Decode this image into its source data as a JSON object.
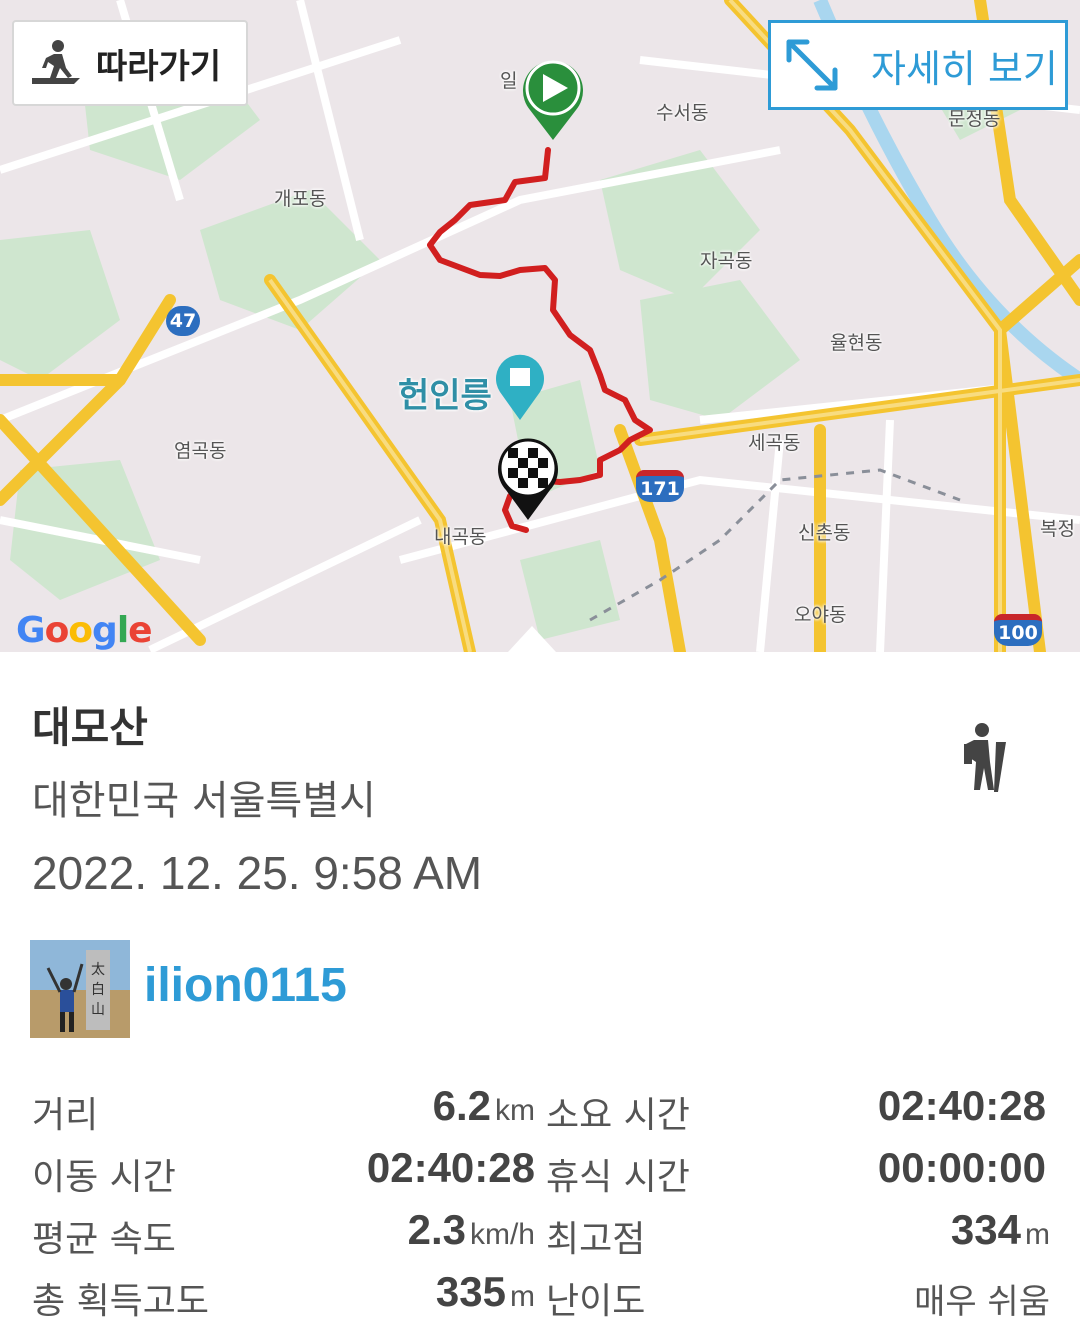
{
  "map": {
    "labels": {
      "il": "일",
      "suseo": "수서동",
      "gaepo": "개포동",
      "jagok": "자곡동",
      "yulhyeon": "율현동",
      "heonilleung": "헌인릉",
      "yeomgok": "염곡동",
      "segok": "세곡동",
      "naegok": "내곡동",
      "sinchon": "신촌동",
      "oya": "오야동",
      "munjeong": "문정동",
      "bokjeong": "복정"
    },
    "shields": {
      "r47": "47",
      "r171": "171",
      "r100": "100"
    },
    "google_logo": [
      "G",
      "o",
      "o",
      "g",
      "l",
      "e"
    ],
    "follow_button": "따라가기",
    "detail_button": "자세히 보기",
    "colors": {
      "route": "#d11f1f",
      "accent": "#2e9bd6",
      "start_pin": "#2a8f3c"
    }
  },
  "activity": {
    "title": "대모산",
    "location": "대한민국 서울특별시",
    "datetime": "2022. 12. 25. 9:58 AM",
    "activity_icon": "hiking-icon"
  },
  "user": {
    "username": "ilion0115",
    "avatar_alt": "profile-photo"
  },
  "stats": {
    "distance_label": "거리",
    "distance_value": "6.2",
    "distance_unit": "km",
    "total_time_label": "소요 시간",
    "total_time_value": "02:40:28",
    "moving_time_label": "이동 시간",
    "moving_time_value": "02:40:28",
    "rest_time_label": "휴식 시간",
    "rest_time_value": "00:00:00",
    "avg_speed_label": "평균 속도",
    "avg_speed_value": "2.3",
    "avg_speed_unit": "km/h",
    "max_alt_label": "최고점",
    "max_alt_value": "334",
    "max_alt_unit": "m",
    "gain_label": "총 획득고도",
    "gain_value": "335",
    "gain_unit": "m",
    "difficulty_label": "난이도",
    "difficulty_value": "매우 쉬움"
  }
}
